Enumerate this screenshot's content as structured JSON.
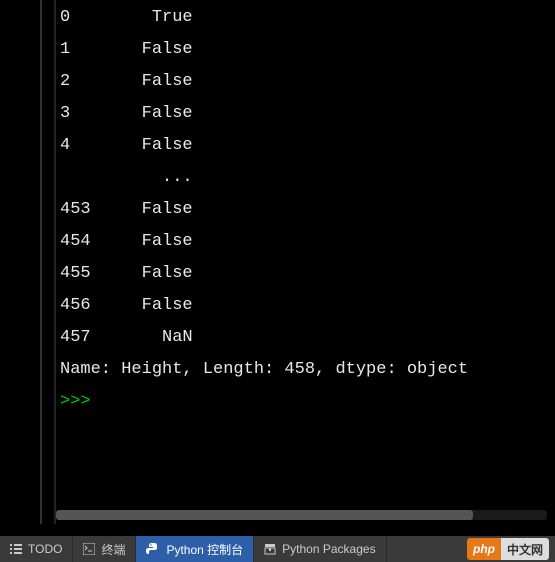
{
  "console": {
    "rows": [
      {
        "index": "0",
        "value": "True"
      },
      {
        "index": "1",
        "value": "False"
      },
      {
        "index": "2",
        "value": "False"
      },
      {
        "index": "3",
        "value": "False"
      },
      {
        "index": "4",
        "value": "False"
      },
      {
        "index": "",
        "value": "..."
      },
      {
        "index": "453",
        "value": "False"
      },
      {
        "index": "454",
        "value": "False"
      },
      {
        "index": "455",
        "value": "False"
      },
      {
        "index": "456",
        "value": "False"
      },
      {
        "index": "457",
        "value": "NaN"
      }
    ],
    "summary": "Name: Height, Length: 458, dtype: object",
    "prompt": ">>> "
  },
  "tabs": {
    "todo": "TODO",
    "terminal": "终端",
    "python_console": "Python 控制台",
    "python_packages": "Python Packages"
  },
  "logo": {
    "left": "php",
    "right": "中文网"
  }
}
